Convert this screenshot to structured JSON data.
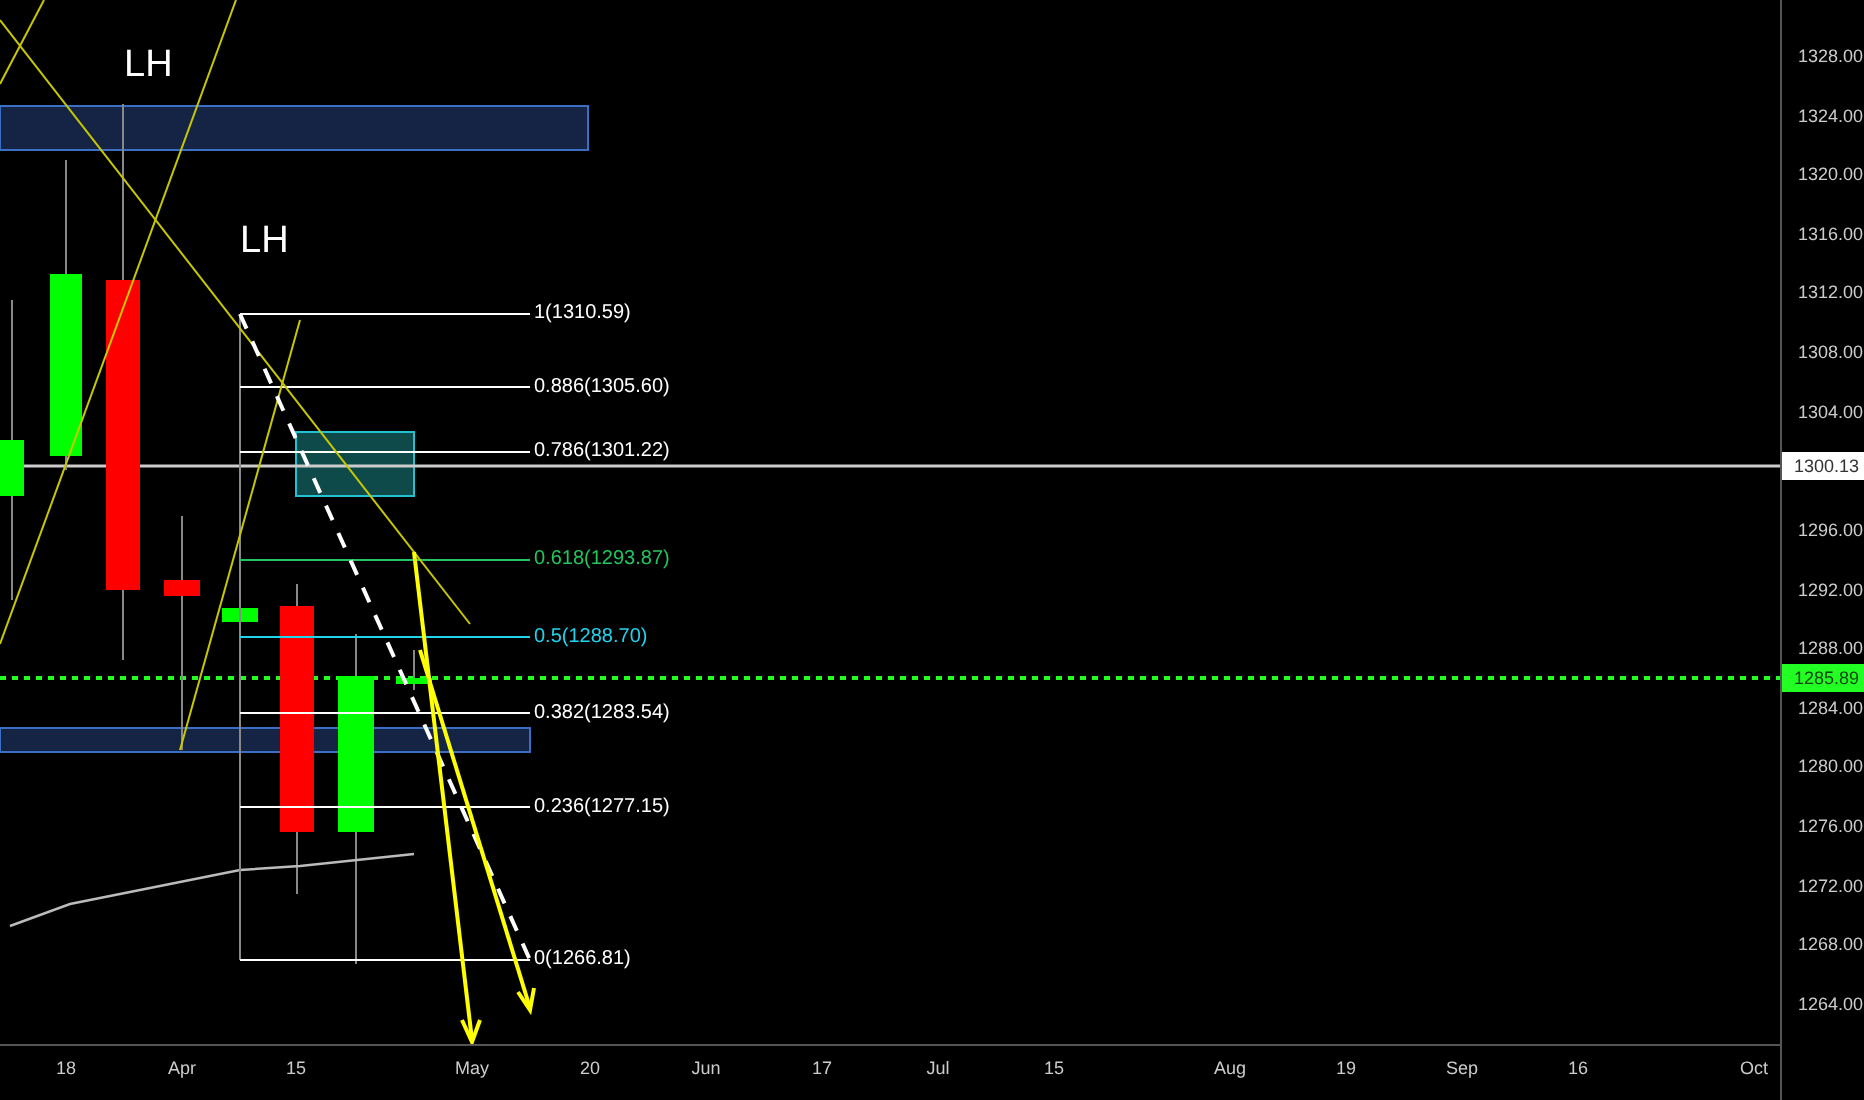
{
  "price_axis": {
    "ticks": [
      "1328.00",
      "1324.00",
      "1320.00",
      "1316.00",
      "1312.00",
      "1308.00",
      "1304.00",
      "1296.00",
      "1292.00",
      "1288.00",
      "1284.00",
      "1280.00",
      "1276.00",
      "1272.00",
      "1268.00",
      "1264.00"
    ],
    "marked_price": "1300.13",
    "last_price": "1285.89"
  },
  "time_axis": {
    "labels": [
      "18",
      "Apr",
      "15",
      "May",
      "20",
      "Jun",
      "17",
      "Jul",
      "15",
      "Aug",
      "19",
      "Sep",
      "16",
      "Oct"
    ]
  },
  "annotations": [
    {
      "text": "LH"
    },
    {
      "text": "LH"
    }
  ],
  "fib_levels": [
    {
      "label": "1(1310.59)",
      "color": "#ffffff"
    },
    {
      "label": "0.886(1305.60)",
      "color": "#ffffff"
    },
    {
      "label": "0.786(1301.22)",
      "color": "#ffffff"
    },
    {
      "label": "0.618(1293.87)",
      "color": "#22c55e"
    },
    {
      "label": "0.5(1288.70)",
      "color": "#22d3ee"
    },
    {
      "label": "0.382(1283.54)",
      "color": "#ffffff"
    },
    {
      "label": "0.236(1277.15)",
      "color": "#ffffff"
    },
    {
      "label": "0(1266.81)",
      "color": "#ffffff"
    }
  ]
}
